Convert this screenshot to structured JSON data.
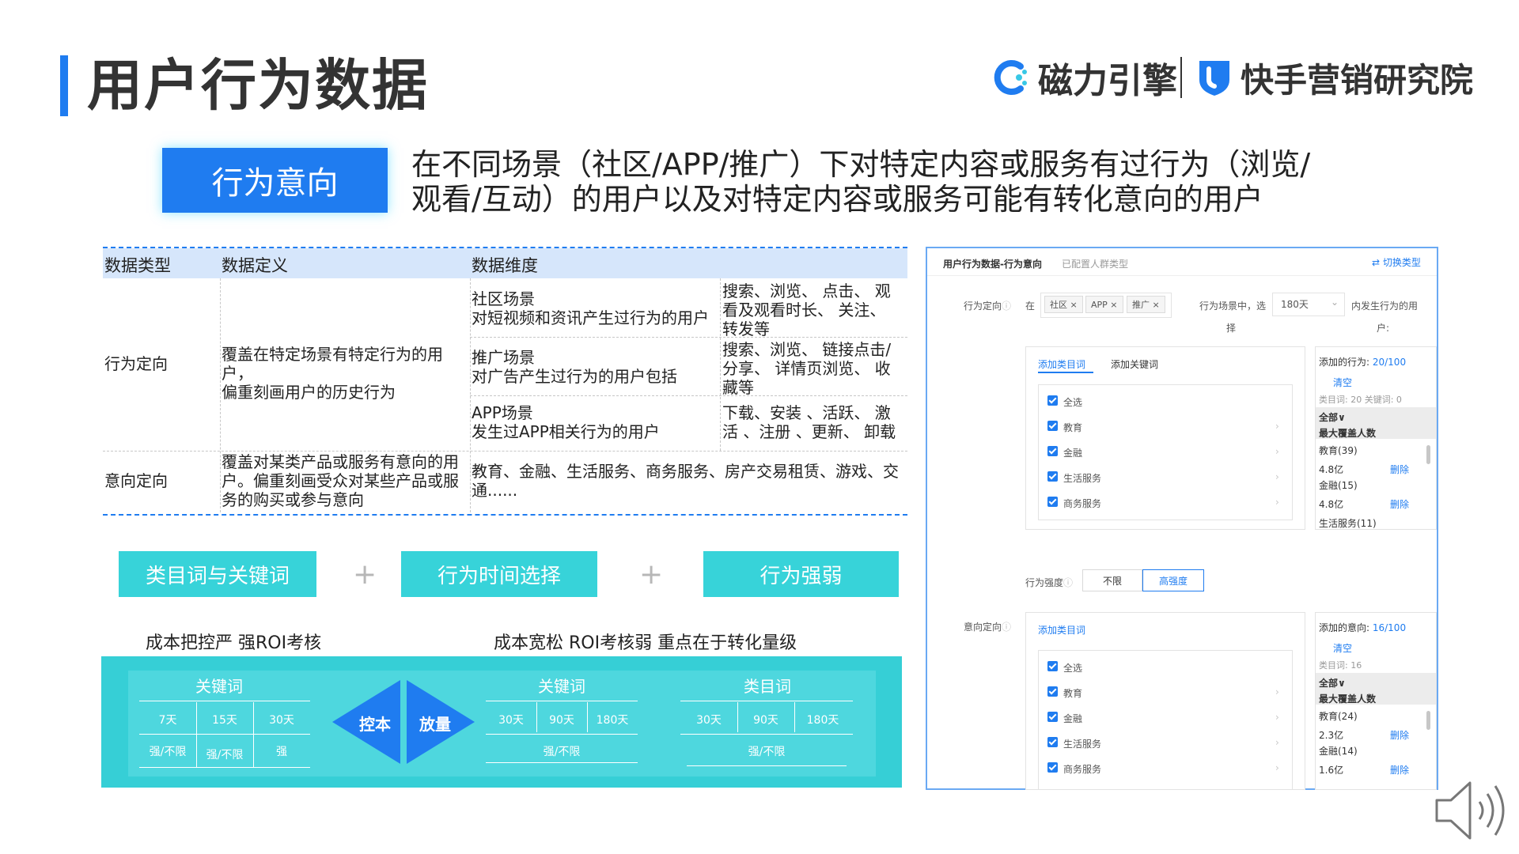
{
  "title": "用户行为数据",
  "logos": {
    "left": "磁力引擎",
    "right": "快手营销研究院"
  },
  "concept": {
    "label": "行为意向",
    "desc_line1": "在不同场景（社区/APP/推广）下对特定内容或服务有过行为（浏览/",
    "desc_line2": "观看/互动）的用户以及对特定内容或服务可能有转化意向的用户"
  },
  "table": {
    "headers": [
      "数据类型",
      "数据定义",
      "数据维度"
    ],
    "row1": {
      "type": "行为定向",
      "def_l1": "覆盖在特定场景有特定行为的用户，",
      "def_l2": "偏重刻画用户的历史行为",
      "scenes": [
        {
          "name": "社区场景",
          "desc": "对短视频和资讯产生过行为的用户",
          "acts_l1": "搜索、浏览、 点击、 观",
          "acts_l2": "看及观看时长、 关注、",
          "acts_l3": "转发等"
        },
        {
          "name": "推广场景",
          "desc": "对广告产生过行为的用户包括",
          "acts_l1": "搜索、浏览、 链接点击/",
          "acts_l2": "分享、 详情页浏览、 收",
          "acts_l3": "藏等"
        },
        {
          "name": "APP场景",
          "desc": "发生过APP相关行为的用户",
          "acts_l1": "下载、安装 、活跃、 激",
          "acts_l2": "活 、注册 、更新、 卸载",
          "acts_l3": ""
        }
      ]
    },
    "row2": {
      "type": "意向定向",
      "def_l1": "覆盖对某类产品或服务有意向的用",
      "def_l2": "户。偏重刻画受众对某些产品或服",
      "def_l3": "务的购买或参与意向",
      "dims_l1": "教育、金融、生活服务、商务服务、房产交易租赁、游戏、交",
      "dims_l2": "通......"
    }
  },
  "pills": [
    "类目词与关键词",
    "行为时间选择",
    "行为强弱"
  ],
  "plus": "+",
  "captions": {
    "left": "成本把控严 强ROI考核",
    "right": "成本宽松  ROI考核弱  重点在于转化量级"
  },
  "bottom": {
    "g1": {
      "title": "关键词",
      "row1": [
        "7天",
        "15天",
        "30天"
      ],
      "row2": [
        "强/不限",
        "强/不限",
        "强"
      ]
    },
    "diamond_left": "控本",
    "diamond_right": "放量",
    "g2": {
      "title": "关键词",
      "row1": [
        "30天",
        "90天",
        "180天"
      ],
      "row2": "强/不限"
    },
    "g3": {
      "title": "类目词",
      "row1": [
        "30天",
        "90天",
        "180天"
      ],
      "row2": "强/不限"
    }
  },
  "screenshot": {
    "header_title": "用户行为数据-行为意向",
    "header_sub": "已配置人群类型",
    "switch_label": "切换类型",
    "behavior_label": "行为定向",
    "in_label": "在",
    "chips": [
      "社区 ×",
      "APP ×",
      "推广 ×"
    ],
    "scene_text": "行为场景中，选",
    "scene_text2": "择",
    "days_select": "180天",
    "occur_text": "内发生行为的用",
    "occur_text2": "户:",
    "tab_category": "添加类目词",
    "tab_keyword": "添加关键词",
    "list1": [
      "全选",
      "教育",
      "金融",
      "生活服务",
      "商务服务"
    ],
    "added_behavior": "添加的行为: ",
    "added_behavior_count": "20/100",
    "clear": "清空",
    "stats1": "类目词: 20   关键词: 0",
    "all": "全部∨",
    "max_cover": "最大覆盖人数",
    "right1": [
      {
        "name": "教育(39)",
        "value": "4.8亿",
        "action": "删除"
      },
      {
        "name": "金融(15)",
        "value": "4.8亿",
        "action": "删除"
      }
    ],
    "right1_cut": "生活服务(11)",
    "strength_label": "行为强度",
    "strength_opts": [
      "不限",
      "高强度"
    ],
    "intent_label": "意向定向",
    "tab_category2": "添加类目词",
    "list2": [
      "全选",
      "教育",
      "金融",
      "生活服务",
      "商务服务"
    ],
    "added_intent": "添加的意向: ",
    "added_intent_count": "16/100",
    "stats2": "类目词: 16",
    "right2": [
      {
        "name": "教育(24)",
        "value": "2.3亿",
        "action": "删除"
      },
      {
        "name": "金融(14)",
        "value": "1.6亿",
        "action": "删除"
      }
    ]
  },
  "colors": {
    "primary": "#1f7cf0",
    "teal": "#37d3d9",
    "logo_blue": "#1f7cf0"
  }
}
